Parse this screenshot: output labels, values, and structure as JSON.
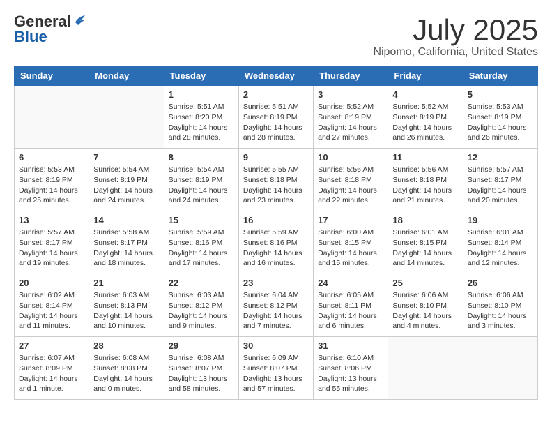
{
  "header": {
    "logo_general": "General",
    "logo_blue": "Blue",
    "month_title": "July 2025",
    "location": "Nipomo, California, United States"
  },
  "days_of_week": [
    "Sunday",
    "Monday",
    "Tuesday",
    "Wednesday",
    "Thursday",
    "Friday",
    "Saturday"
  ],
  "weeks": [
    [
      {
        "day": "",
        "sunrise": "",
        "sunset": "",
        "daylight": "",
        "empty": true
      },
      {
        "day": "",
        "sunrise": "",
        "sunset": "",
        "daylight": "",
        "empty": true
      },
      {
        "day": "1",
        "sunrise": "Sunrise: 5:51 AM",
        "sunset": "Sunset: 8:20 PM",
        "daylight": "Daylight: 14 hours and 28 minutes.",
        "empty": false
      },
      {
        "day": "2",
        "sunrise": "Sunrise: 5:51 AM",
        "sunset": "Sunset: 8:19 PM",
        "daylight": "Daylight: 14 hours and 28 minutes.",
        "empty": false
      },
      {
        "day": "3",
        "sunrise": "Sunrise: 5:52 AM",
        "sunset": "Sunset: 8:19 PM",
        "daylight": "Daylight: 14 hours and 27 minutes.",
        "empty": false
      },
      {
        "day": "4",
        "sunrise": "Sunrise: 5:52 AM",
        "sunset": "Sunset: 8:19 PM",
        "daylight": "Daylight: 14 hours and 26 minutes.",
        "empty": false
      },
      {
        "day": "5",
        "sunrise": "Sunrise: 5:53 AM",
        "sunset": "Sunset: 8:19 PM",
        "daylight": "Daylight: 14 hours and 26 minutes.",
        "empty": false
      }
    ],
    [
      {
        "day": "6",
        "sunrise": "Sunrise: 5:53 AM",
        "sunset": "Sunset: 8:19 PM",
        "daylight": "Daylight: 14 hours and 25 minutes.",
        "empty": false
      },
      {
        "day": "7",
        "sunrise": "Sunrise: 5:54 AM",
        "sunset": "Sunset: 8:19 PM",
        "daylight": "Daylight: 14 hours and 24 minutes.",
        "empty": false
      },
      {
        "day": "8",
        "sunrise": "Sunrise: 5:54 AM",
        "sunset": "Sunset: 8:19 PM",
        "daylight": "Daylight: 14 hours and 24 minutes.",
        "empty": false
      },
      {
        "day": "9",
        "sunrise": "Sunrise: 5:55 AM",
        "sunset": "Sunset: 8:18 PM",
        "daylight": "Daylight: 14 hours and 23 minutes.",
        "empty": false
      },
      {
        "day": "10",
        "sunrise": "Sunrise: 5:56 AM",
        "sunset": "Sunset: 8:18 PM",
        "daylight": "Daylight: 14 hours and 22 minutes.",
        "empty": false
      },
      {
        "day": "11",
        "sunrise": "Sunrise: 5:56 AM",
        "sunset": "Sunset: 8:18 PM",
        "daylight": "Daylight: 14 hours and 21 minutes.",
        "empty": false
      },
      {
        "day": "12",
        "sunrise": "Sunrise: 5:57 AM",
        "sunset": "Sunset: 8:17 PM",
        "daylight": "Daylight: 14 hours and 20 minutes.",
        "empty": false
      }
    ],
    [
      {
        "day": "13",
        "sunrise": "Sunrise: 5:57 AM",
        "sunset": "Sunset: 8:17 PM",
        "daylight": "Daylight: 14 hours and 19 minutes.",
        "empty": false
      },
      {
        "day": "14",
        "sunrise": "Sunrise: 5:58 AM",
        "sunset": "Sunset: 8:17 PM",
        "daylight": "Daylight: 14 hours and 18 minutes.",
        "empty": false
      },
      {
        "day": "15",
        "sunrise": "Sunrise: 5:59 AM",
        "sunset": "Sunset: 8:16 PM",
        "daylight": "Daylight: 14 hours and 17 minutes.",
        "empty": false
      },
      {
        "day": "16",
        "sunrise": "Sunrise: 5:59 AM",
        "sunset": "Sunset: 8:16 PM",
        "daylight": "Daylight: 14 hours and 16 minutes.",
        "empty": false
      },
      {
        "day": "17",
        "sunrise": "Sunrise: 6:00 AM",
        "sunset": "Sunset: 8:15 PM",
        "daylight": "Daylight: 14 hours and 15 minutes.",
        "empty": false
      },
      {
        "day": "18",
        "sunrise": "Sunrise: 6:01 AM",
        "sunset": "Sunset: 8:15 PM",
        "daylight": "Daylight: 14 hours and 14 minutes.",
        "empty": false
      },
      {
        "day": "19",
        "sunrise": "Sunrise: 6:01 AM",
        "sunset": "Sunset: 8:14 PM",
        "daylight": "Daylight: 14 hours and 12 minutes.",
        "empty": false
      }
    ],
    [
      {
        "day": "20",
        "sunrise": "Sunrise: 6:02 AM",
        "sunset": "Sunset: 8:14 PM",
        "daylight": "Daylight: 14 hours and 11 minutes.",
        "empty": false
      },
      {
        "day": "21",
        "sunrise": "Sunrise: 6:03 AM",
        "sunset": "Sunset: 8:13 PM",
        "daylight": "Daylight: 14 hours and 10 minutes.",
        "empty": false
      },
      {
        "day": "22",
        "sunrise": "Sunrise: 6:03 AM",
        "sunset": "Sunset: 8:12 PM",
        "daylight": "Daylight: 14 hours and 9 minutes.",
        "empty": false
      },
      {
        "day": "23",
        "sunrise": "Sunrise: 6:04 AM",
        "sunset": "Sunset: 8:12 PM",
        "daylight": "Daylight: 14 hours and 7 minutes.",
        "empty": false
      },
      {
        "day": "24",
        "sunrise": "Sunrise: 6:05 AM",
        "sunset": "Sunset: 8:11 PM",
        "daylight": "Daylight: 14 hours and 6 minutes.",
        "empty": false
      },
      {
        "day": "25",
        "sunrise": "Sunrise: 6:06 AM",
        "sunset": "Sunset: 8:10 PM",
        "daylight": "Daylight: 14 hours and 4 minutes.",
        "empty": false
      },
      {
        "day": "26",
        "sunrise": "Sunrise: 6:06 AM",
        "sunset": "Sunset: 8:10 PM",
        "daylight": "Daylight: 14 hours and 3 minutes.",
        "empty": false
      }
    ],
    [
      {
        "day": "27",
        "sunrise": "Sunrise: 6:07 AM",
        "sunset": "Sunset: 8:09 PM",
        "daylight": "Daylight: 14 hours and 1 minute.",
        "empty": false
      },
      {
        "day": "28",
        "sunrise": "Sunrise: 6:08 AM",
        "sunset": "Sunset: 8:08 PM",
        "daylight": "Daylight: 14 hours and 0 minutes.",
        "empty": false
      },
      {
        "day": "29",
        "sunrise": "Sunrise: 6:08 AM",
        "sunset": "Sunset: 8:07 PM",
        "daylight": "Daylight: 13 hours and 58 minutes.",
        "empty": false
      },
      {
        "day": "30",
        "sunrise": "Sunrise: 6:09 AM",
        "sunset": "Sunset: 8:07 PM",
        "daylight": "Daylight: 13 hours and 57 minutes.",
        "empty": false
      },
      {
        "day": "31",
        "sunrise": "Sunrise: 6:10 AM",
        "sunset": "Sunset: 8:06 PM",
        "daylight": "Daylight: 13 hours and 55 minutes.",
        "empty": false
      },
      {
        "day": "",
        "sunrise": "",
        "sunset": "",
        "daylight": "",
        "empty": true
      },
      {
        "day": "",
        "sunrise": "",
        "sunset": "",
        "daylight": "",
        "empty": true
      }
    ]
  ]
}
